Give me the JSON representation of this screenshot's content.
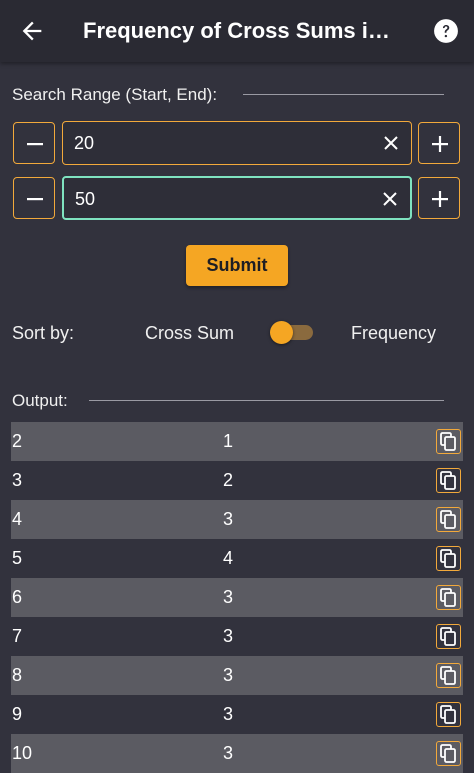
{
  "appbar": {
    "title": "Frequency of Cross Sums in ...",
    "back_icon": "arrow-left-icon",
    "help_icon": "help-circle-icon"
  },
  "search_range": {
    "label": "Search Range (Start, End):",
    "start_value": "20",
    "end_value": "50"
  },
  "submit_label": "Submit",
  "sort": {
    "label": "Sort by:",
    "option_left": "Cross Sum",
    "option_right": "Frequency",
    "selected": "Cross Sum"
  },
  "output": {
    "label": "Output:",
    "rows": [
      {
        "sum": "2",
        "freq": "1"
      },
      {
        "sum": "3",
        "freq": "2"
      },
      {
        "sum": "4",
        "freq": "3"
      },
      {
        "sum": "5",
        "freq": "4"
      },
      {
        "sum": "6",
        "freq": "3"
      },
      {
        "sum": "7",
        "freq": "3"
      },
      {
        "sum": "8",
        "freq": "3"
      },
      {
        "sum": "9",
        "freq": "3"
      },
      {
        "sum": "10",
        "freq": "3"
      }
    ]
  },
  "colors": {
    "background": "#32323d",
    "appbar": "#2a2a33",
    "accent": "#f5a623",
    "focus": "#7fe3c0",
    "row_alt": "#5b5b62"
  }
}
